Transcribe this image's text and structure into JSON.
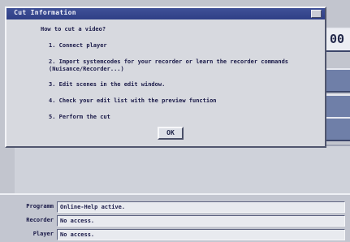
{
  "dialog": {
    "title": " Cut Information",
    "heading": "How to cut a video?",
    "steps": [
      "1. Connect player",
      "2. Import systemcodes for your recorder or learn the recorder commands (Nuisance/Recorder...)",
      "3. Edit scenes in the edit window.",
      "4. Check your edit list with the preview function",
      "5. Perform the cut"
    ],
    "ok_label": "OK"
  },
  "side": {
    "top_button": "00"
  },
  "status": {
    "rows": [
      {
        "label": "Programm",
        "value": "Online-Help active."
      },
      {
        "label": "Recorder",
        "value": "No access."
      },
      {
        "label": "Player",
        "value": "No access."
      }
    ]
  }
}
